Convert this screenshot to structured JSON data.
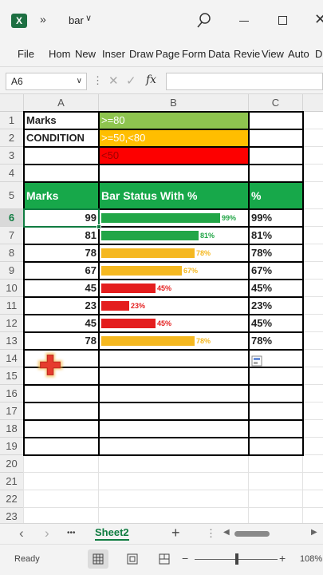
{
  "app": {
    "logo": "X",
    "qat_more": "»",
    "title": "bar",
    "title_chevron": "∨",
    "close": "✕"
  },
  "ribbon_tabs": [
    "File",
    "Hom",
    "New",
    "Inser",
    "Draw",
    "Page",
    "Form",
    "Data",
    "Revie",
    "View",
    "Auto",
    "D"
  ],
  "formula_bar": {
    "name_box": "A6",
    "chevron": "∨",
    "dots": "⋮",
    "cancel": "✕",
    "enter": "✓",
    "fx": "fx",
    "value": ""
  },
  "columns": [
    "A",
    "B",
    "C"
  ],
  "rows": [
    "1",
    "2",
    "3",
    "4",
    "5",
    "6",
    "7",
    "8",
    "9",
    "10",
    "11",
    "12",
    "13",
    "14",
    "15",
    "16",
    "17",
    "18",
    "19",
    "20",
    "21",
    "22",
    "23"
  ],
  "legend": {
    "a1": "Marks",
    "a2": "CONDITION",
    "b1": ">=80",
    "b2": ">=50,<80",
    "b3": "<50"
  },
  "table_header": {
    "marks": "Marks",
    "bar": "Bar Status With %",
    "pct": "%"
  },
  "data_rows": [
    {
      "mark": 99,
      "pct_label": "99%",
      "bar_label": "99%",
      "level": "high"
    },
    {
      "mark": 81,
      "pct_label": "81%",
      "bar_label": "81%",
      "level": "high"
    },
    {
      "mark": 78,
      "pct_label": "78%",
      "bar_label": "78%",
      "level": "mid"
    },
    {
      "mark": 67,
      "pct_label": "67%",
      "bar_label": "67%",
      "level": "mid"
    },
    {
      "mark": 45,
      "pct_label": "45%",
      "bar_label": "45%",
      "level": "low"
    },
    {
      "mark": 23,
      "pct_label": "23%",
      "bar_label": "23%",
      "level": "low"
    },
    {
      "mark": 45,
      "pct_label": "45%",
      "bar_label": "45%",
      "level": "low"
    },
    {
      "mark": 78,
      "pct_label": "78%",
      "bar_label": "78%",
      "level": "mid"
    }
  ],
  "colors": {
    "high": "#22a647",
    "mid": "#f5b820",
    "low": "#e41e1e",
    "legend_green": "#8ec44f",
    "legend_orange": "#ffbe00",
    "legend_red": "#fd0000",
    "header_green": "#17a84a",
    "selection": "#107c41"
  },
  "sheet_tabs": {
    "prev": "‹",
    "next": "›",
    "more": "•••",
    "active": "Sheet2",
    "add": "+"
  },
  "status": {
    "ready": "Ready",
    "zoom": "108%",
    "minus": "−",
    "plus": "+"
  }
}
